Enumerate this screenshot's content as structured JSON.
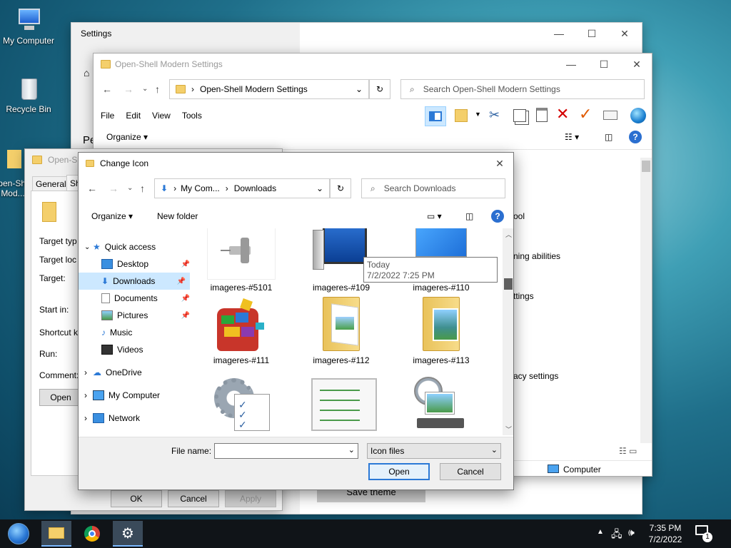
{
  "desktop": {
    "icons": [
      {
        "label": "My Computer"
      },
      {
        "label": "Recycle Bin"
      },
      {
        "label": "Open-Shell Mod..."
      }
    ]
  },
  "settings_window": {
    "title": "Settings",
    "section_heading_partial": "Pe",
    "save_theme_label": "Save theme"
  },
  "explorer_window": {
    "title": "Open-Shell Modern Settings",
    "address": "Open-Shell Modern Settings",
    "search_placeholder": "Search Open-Shell Modern Settings",
    "menu": [
      "File",
      "Edit",
      "View",
      "Tools"
    ],
    "organize": "Organize",
    "right_items": [
      "ool",
      "ning abilities",
      "ttings",
      "acy settings"
    ],
    "status_computer": "Computer"
  },
  "properties_window": {
    "title": "Open-Sh",
    "tabs": [
      "General",
      "Sh"
    ],
    "labels": [
      "Target typ",
      "Target loc",
      "Target:",
      "Start in:",
      "Shortcut k",
      "Run:",
      "Comment:"
    ],
    "open_btn": "Open",
    "ok": "OK",
    "cancel": "Cancel",
    "apply": "Apply"
  },
  "change_icon_dialog": {
    "title": "Change Icon",
    "breadcrumb": [
      "My Com...",
      "Downloads"
    ],
    "search_placeholder": "Search Downloads",
    "organize": "Organize",
    "new_folder": "New folder",
    "nav": {
      "quick_access": "Quick access",
      "quick_items": [
        "Desktop",
        "Downloads",
        "Documents",
        "Pictures",
        "Music",
        "Videos"
      ],
      "onedrive": "OneDrive",
      "my_computer": "My Computer",
      "network": "Network"
    },
    "files": [
      {
        "name": "imageres-#5101"
      },
      {
        "name": "imageres-#109"
      },
      {
        "name": "imageres-#110"
      },
      {
        "name": "imageres-#111"
      },
      {
        "name": "imageres-#112"
      },
      {
        "name": "imageres-#113"
      },
      {
        "name": ""
      },
      {
        "name": ""
      },
      {
        "name": ""
      }
    ],
    "tooltip": {
      "line1": "Today",
      "line2": "7/2/2022 7:25 PM"
    },
    "filename_label": "File name:",
    "filename_value": "",
    "filetype_value": "Icon files",
    "open": "Open",
    "cancel": "Cancel"
  },
  "taskbar": {
    "time": "7:35 PM",
    "date": "7/2/2022",
    "notification_count": "1"
  },
  "colors": {
    "accent": "#2b79d6",
    "selected_bg": "#cce8ff",
    "taskbar": "#101418"
  }
}
